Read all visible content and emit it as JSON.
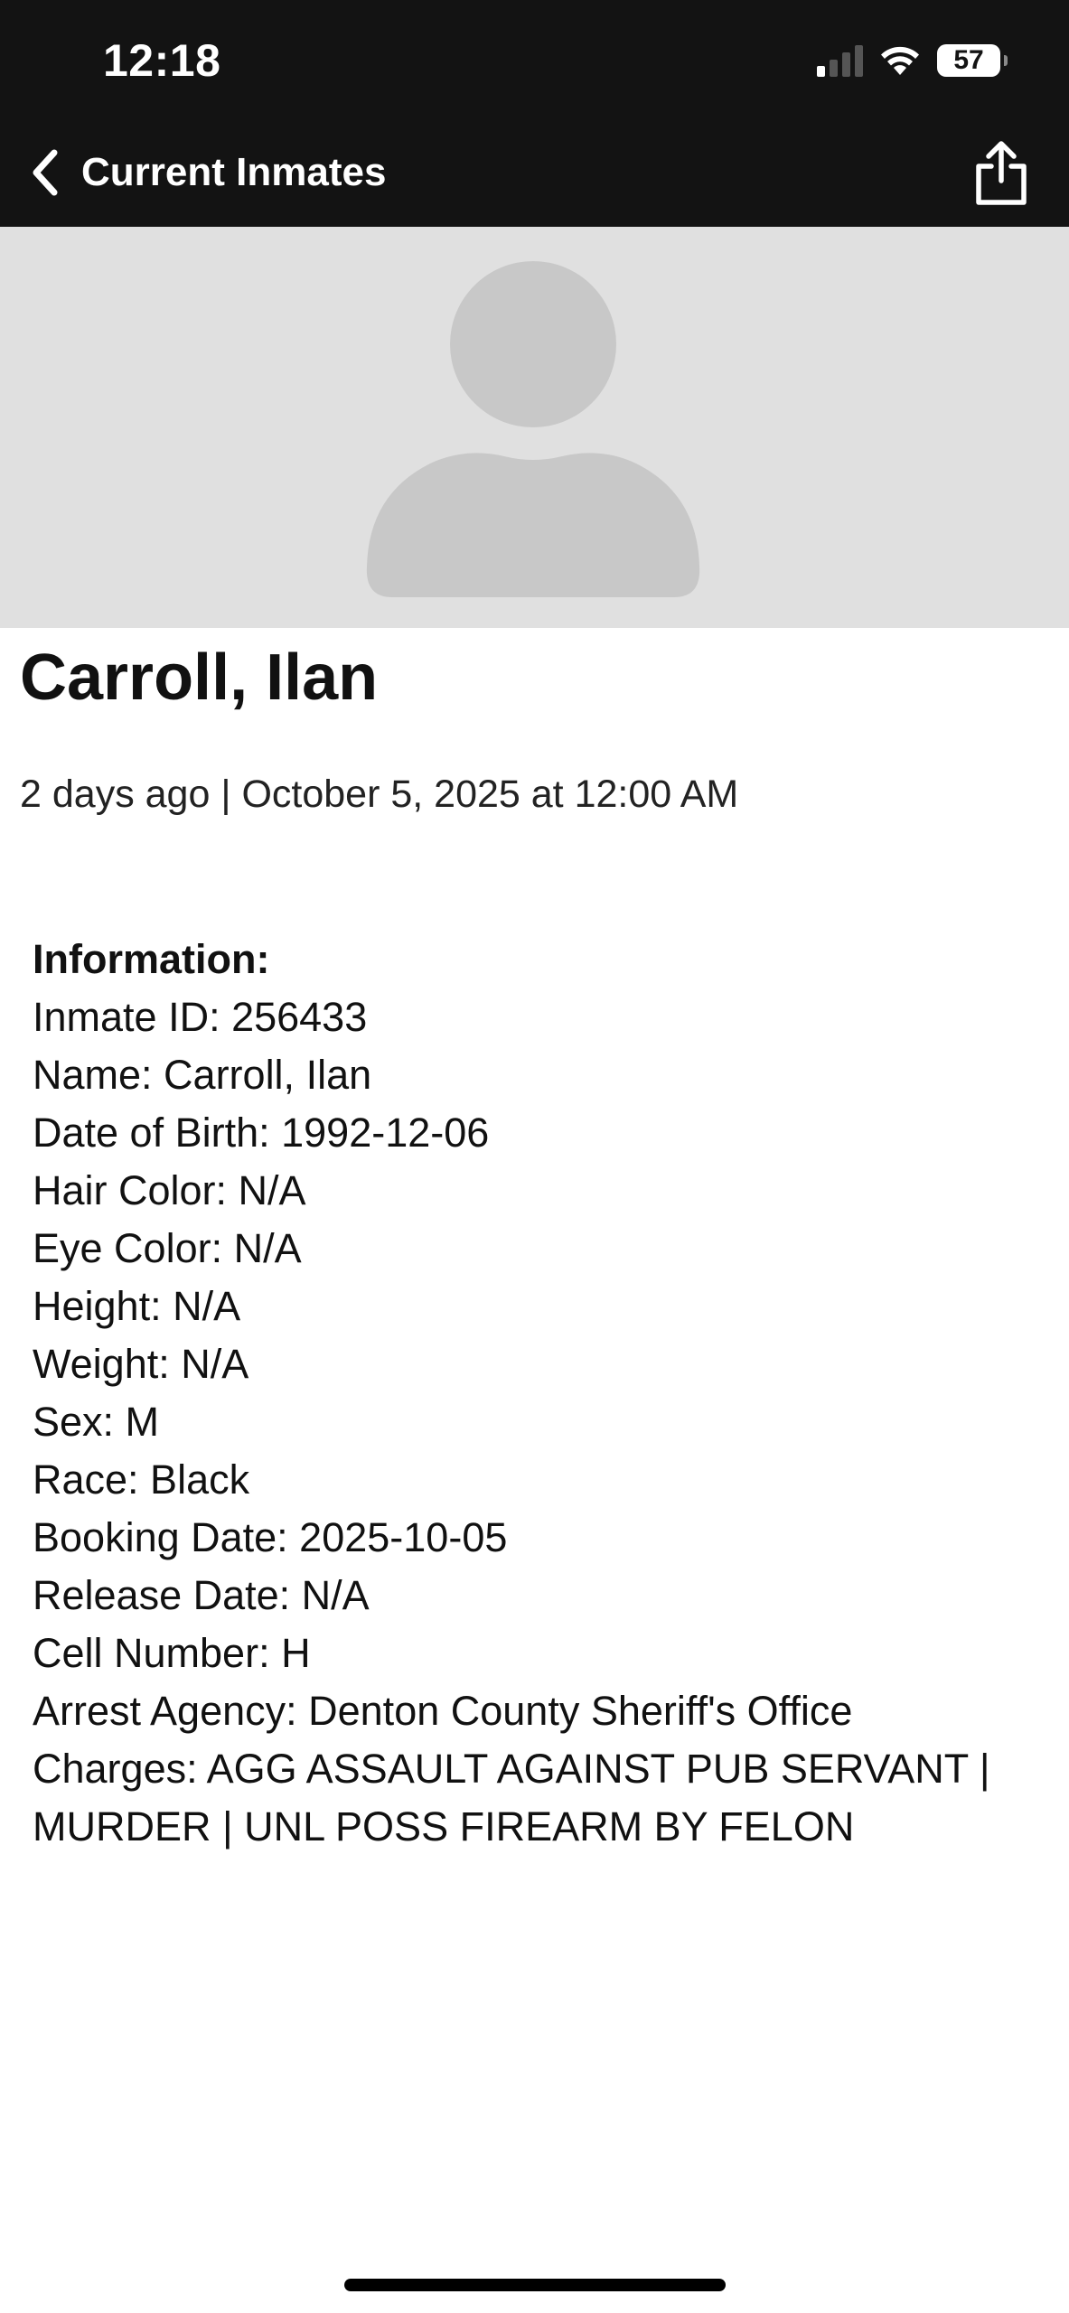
{
  "status_bar": {
    "time": "12:18",
    "battery_level": "57",
    "signal_bars_active": 1,
    "signal_bars_total": 4
  },
  "nav": {
    "back_label": "Current Inmates",
    "back_icon": "chevron-left-icon",
    "share_icon": "share-icon"
  },
  "profile": {
    "avatar_icon": "person-placeholder-icon",
    "name": "Carroll, Ilan",
    "meta": "2 days ago | October 5, 2025 at 12:00 AM"
  },
  "info": {
    "heading": "Information:",
    "lines": [
      "Inmate ID: 256433",
      "Name: Carroll, Ilan",
      "Date of Birth: 1992-12-06",
      "Hair Color: N/A",
      "Eye Color: N/A",
      "Height: N/A",
      "Weight: N/A",
      "Sex: M",
      "Race: Black",
      "Booking Date: 2025-10-05",
      "Release Date: N/A",
      "Cell Number: H",
      "Arrest Agency: Denton County Sheriff's Office",
      "Charges: AGG ASSAULT AGAINST PUB SERVANT | MURDER | UNL POSS FIREARM BY FELON"
    ]
  },
  "colors": {
    "header_background": "#131313",
    "avatar_background": "#e0e0e0",
    "avatar_silhouette": "#c8c8c8",
    "text_primary": "#111111"
  }
}
